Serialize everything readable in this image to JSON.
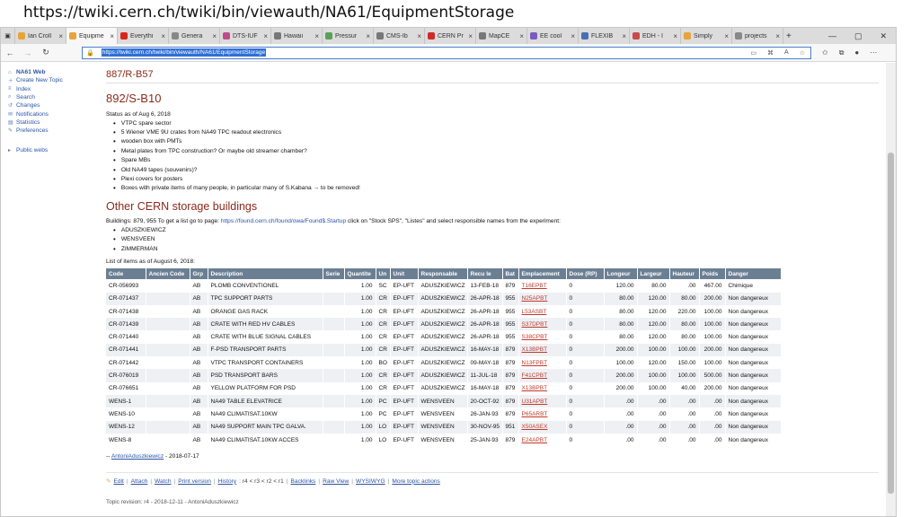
{
  "slide_url": "https://twiki.cern.ch/twiki/bin/viewauth/NA61/EquipmentStorage",
  "tabs": [
    {
      "label": "Ian Croll",
      "color": "#e8a33a"
    },
    {
      "label": "Equipme",
      "color": "#e8a33a",
      "active": true
    },
    {
      "label": "Everythi",
      "color": "#d9261c"
    },
    {
      "label": "Genera",
      "color": "#888888"
    },
    {
      "label": "DTS-IUF",
      "color": "#c04b8b"
    },
    {
      "label": "Hawaii",
      "color": "#777777"
    },
    {
      "label": "Pressur",
      "color": "#5aa05a"
    },
    {
      "label": "CMS-Ib",
      "color": "#777777"
    },
    {
      "label": "CERN Pr",
      "color": "#d02a2a"
    },
    {
      "label": "MapCE",
      "color": "#777777"
    },
    {
      "label": "EE cool",
      "color": "#7a5cc0"
    },
    {
      "label": "FLEXIB",
      "color": "#4a6fb0"
    },
    {
      "label": "EDH - I",
      "color": "#c94a4a"
    },
    {
      "label": "Simply",
      "color": "#e8a33a"
    },
    {
      "label": "projects",
      "color": "#888888"
    }
  ],
  "address_url": "https://twiki.cern.ch/twiki/bin/viewauth/NA61/EquipmentStorage",
  "sidebar": {
    "web": "NA61 Web",
    "items": [
      "Create New Topic",
      "Index",
      "Search",
      "Changes",
      "Notifications",
      "Statistics",
      "Preferences"
    ],
    "public": "Public webs"
  },
  "page": {
    "sub_heading": "887/R-B57",
    "title": "892/S-B10",
    "status": "Status as of Aug 6, 2018",
    "bullets": [
      "VTPC spare sector",
      "5 Wiener VME 9U crates from NA49 TPC readout electronics",
      "wooden box with PMTs",
      "Metal plates from TPC construction? Or maybe old streamer chamber?",
      "Spare MBs",
      "Old NA49 tapes (souvenirs)?",
      "Plexi covers for posters",
      "Boxes with private items of many people, in particular many of S.Kabana → to be removed!"
    ],
    "other_title": "Other CERN storage buildings",
    "buildings_pre": "Buildings: 879, 955 To get a list go to page: ",
    "buildings_link": "https://found.cern.ch/found/owa/Found$.Startup",
    "buildings_post": " click on \"Stock SPS\", \"Listes\" and select responsible names from the experiment:",
    "names": [
      "ADUSZKIEWICZ",
      "WENSVEEN",
      "ZIMMERMAN"
    ],
    "list_label": "List of items as of August 6, 2018:",
    "table_headers": [
      "Code",
      "Ancien Code",
      "Grp",
      "Description",
      "Serie",
      "Quantite",
      "Un",
      "Unit",
      "Responsable",
      "Recu le",
      "Bat",
      "Emplacement",
      "Dose (RP)",
      "Longeur",
      "Largeur",
      "Hauteur",
      "Poids",
      "Danger"
    ],
    "rows": [
      [
        "CR-056993",
        "",
        "AB",
        "PLOMB CONVENTIONEL",
        "",
        "1.00",
        "SC",
        "EP-UFT",
        "ADUSZKIEWICZ",
        "13-FEB-18",
        "879",
        "T16EPBT",
        "0",
        "120.00",
        "80.00",
        ".00",
        "467.00",
        "Chimique"
      ],
      [
        "CR-071437",
        "",
        "AB",
        "TPC SUPPORT PARTS",
        "",
        "1.00",
        "CR",
        "EP-UFT",
        "ADUSZKIEWICZ",
        "26-APR-18",
        "955",
        "N25APBT",
        "0",
        "80.00",
        "120.00",
        "80.00",
        "200.00",
        "Non dangereux"
      ],
      [
        "CR-071438",
        "",
        "AB",
        "ORANGE GAS RACK",
        "",
        "1.00",
        "CR",
        "EP-UFT",
        "ADUSZKIEWICZ",
        "26-APR-18",
        "955",
        "L53ASBT",
        "0",
        "80.00",
        "120.00",
        "220.00",
        "100.00",
        "Non dangereux"
      ],
      [
        "CR-071439",
        "",
        "AB",
        "CRATE WITH RED HV CABLES",
        "",
        "1.00",
        "CR",
        "EP-UFT",
        "ADUSZKIEWICZ",
        "26-APR-18",
        "955",
        "S37DPBT",
        "0",
        "80.00",
        "120.00",
        "80.00",
        "100.00",
        "Non dangereux"
      ],
      [
        "CR-071440",
        "",
        "AB",
        "CRATE WITH BLUE SIGNAL CABLES",
        "",
        "1.00",
        "CR",
        "EP-UFT",
        "ADUSZKIEWICZ",
        "26-APR-18",
        "955",
        "S38CPBT",
        "0",
        "80.00",
        "120.00",
        "80.00",
        "100.00",
        "Non dangereux"
      ],
      [
        "CR-071441",
        "",
        "AB",
        "F-PSD TRANSPORT PARTS",
        "",
        "1.00",
        "CR",
        "EP-UFT",
        "ADUSZKIEWICZ",
        "16-MAY-18",
        "879",
        "X13BPBT",
        "0",
        "200.00",
        "100.00",
        "100.00",
        "200.00",
        "Non dangereux"
      ],
      [
        "CR-071442",
        "",
        "AB",
        "VTPC TRANSPORT CONTAINERS",
        "",
        "1.00",
        "BO",
        "EP-UFT",
        "ADUSZKIEWICZ",
        "09-MAY-18",
        "879",
        "N13FPBT",
        "0",
        "100.00",
        "120.00",
        "150.00",
        "100.00",
        "Non dangereux"
      ],
      [
        "CR-076019",
        "",
        "AB",
        "PSD TRANSPORT BARS",
        "",
        "1.00",
        "CR",
        "EP-UFT",
        "ADUSZKIEWICZ",
        "11-JUL-18",
        "879",
        "F41CPBT",
        "0",
        "200.00",
        "100.00",
        "100.00",
        "500.00",
        "Non dangereux"
      ],
      [
        "CR-076651",
        "",
        "AB",
        "YELLOW PLATFORM FOR PSD",
        "",
        "1.00",
        "CR",
        "EP-UFT",
        "ADUSZKIEWICZ",
        "16-MAY-18",
        "879",
        "X13BPBT",
        "0",
        "200.00",
        "100.00",
        "40.00",
        "200.00",
        "Non dangereux"
      ],
      [
        "WENS-1",
        "",
        "AB",
        "NA49 TABLE ELEVATRICE",
        "",
        "1.00",
        "PC",
        "EP-UFT",
        "WENSVEEN",
        "20-OCT-92",
        "879",
        "U31APBT",
        "0",
        ".00",
        ".00",
        ".00",
        ".00",
        "Non dangereux"
      ],
      [
        "WENS-10",
        "",
        "AB",
        "NA49 CLIMATISAT.10KW",
        "",
        "1.00",
        "PC",
        "EP-UFT",
        "WENSVEEN",
        "26-JAN-93",
        "879",
        "P65ARBT",
        "0",
        ".00",
        ".00",
        ".00",
        ".00",
        "Non dangereux"
      ],
      [
        "WENS-12",
        "",
        "AB",
        "NA49 SUPPORT MAIN TPC GALVA.",
        "",
        "1.00",
        "LO",
        "EP-UFT",
        "WENSVEEN",
        "30-NOV-95",
        "951",
        "X50ASEX",
        "0",
        ".00",
        ".00",
        ".00",
        ".00",
        "Non dangereux"
      ],
      [
        "WENS-8",
        "",
        "AB",
        "NA49 CLIMATISAT.10KW ACCES",
        "",
        "1.00",
        "LO",
        "EP-UFT",
        "WENSVEEN",
        "25-JAN-93",
        "879",
        "E24APBT",
        "0",
        ".00",
        ".00",
        ".00",
        ".00",
        "Non dangereux"
      ]
    ],
    "signature_prefix": "-- ",
    "signature_link": "AntoniAduszkiewicz",
    "signature_date": " - 2018-07-17"
  },
  "actions": {
    "edit": "Edit",
    "attach": "Attach",
    "watch": "Watch",
    "print": "Print version",
    "history": "History",
    "history_rest": ": r4 < r3 < r2 < r1",
    "backlinks": "Backlinks",
    "raw": "Raw View",
    "wysiwyg": "WYSIWYG",
    "more": "More topic actions"
  },
  "revision": "Topic revision: r4 - 2018-12-11 - AntoniAduszkiewicz"
}
